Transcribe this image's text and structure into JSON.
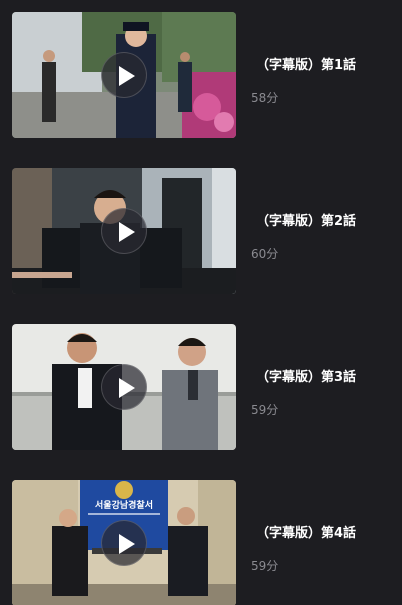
{
  "episodes": [
    {
      "title": "（字幕版）第1話",
      "duration": "58分"
    },
    {
      "title": "（字幕版）第2話",
      "duration": "60分"
    },
    {
      "title": "（字幕版）第3話",
      "duration": "59分"
    },
    {
      "title": "（字幕版）第4話",
      "duration": "59分"
    }
  ],
  "thumbnail_signs": {
    "episode_4_banner": "서울강남경찰서"
  },
  "colors": {
    "background": "#1d1d21",
    "title": "#ffffff",
    "duration": "#8a8a90",
    "play_button": "#28282f"
  },
  "icons": {
    "play": "play-icon"
  }
}
